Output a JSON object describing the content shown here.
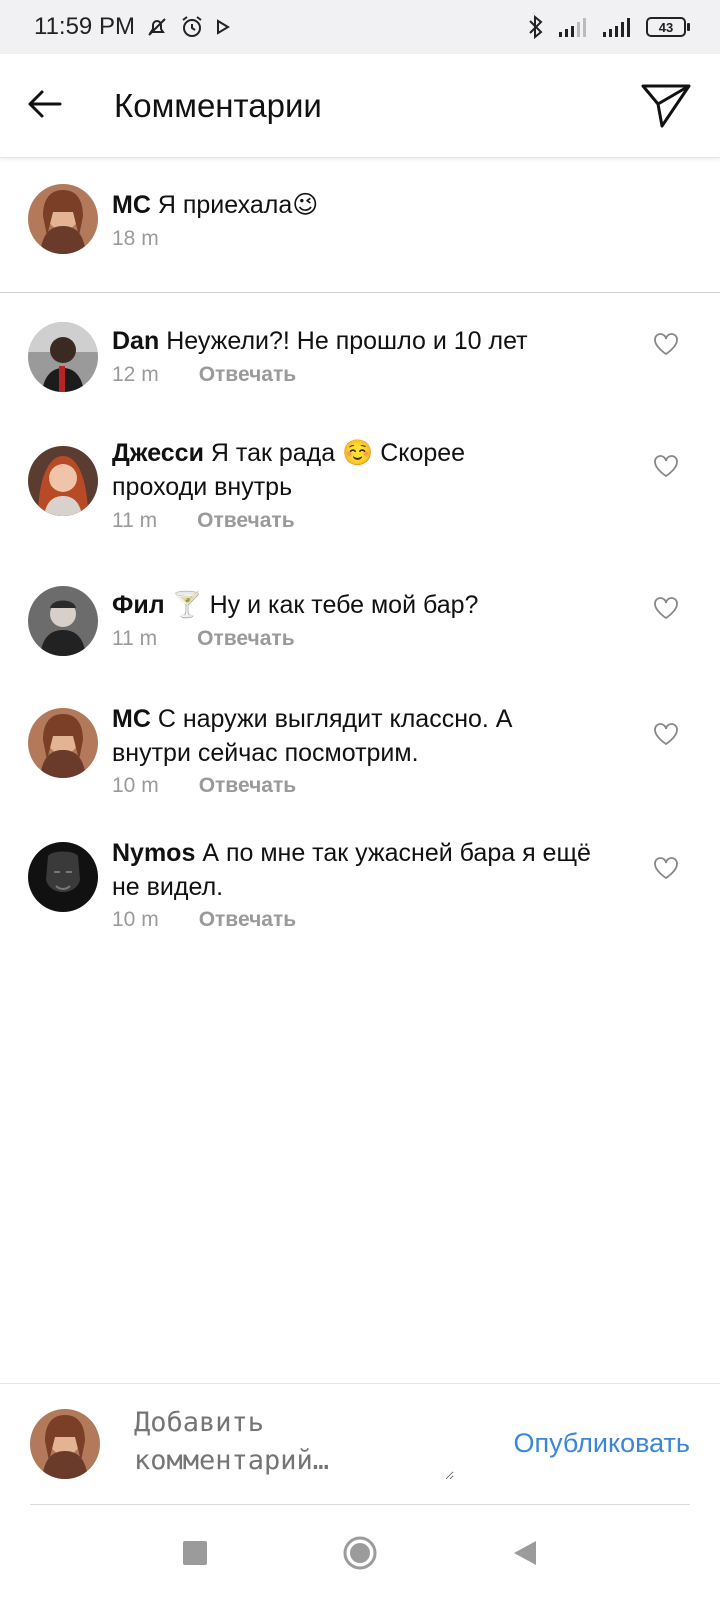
{
  "status_bar": {
    "time": "11:59 PM",
    "battery": "43"
  },
  "header": {
    "title": "Комментарии"
  },
  "caption": {
    "username": "MC",
    "text": "Я приехала😉",
    "time": "18 m"
  },
  "comments": [
    {
      "username": "Dan",
      "text": "Неужели?! Не прошло и 10 лет",
      "time": "12 m",
      "reply": "Отвечать"
    },
    {
      "username": "Джесси",
      "text": "Я так рада ☺️ Скорее проходи внутрь",
      "time": "11 m",
      "reply": "Отвечать"
    },
    {
      "username": "Фил",
      "text": "🍸 Ну и как тебе мой бар?",
      "time": "11 m",
      "reply": "Отвечать"
    },
    {
      "username": "MC",
      "text": "С наружи выглядит классно. А внутри сейчас посмотрим.",
      "time": "10 m",
      "reply": "Отвечать"
    },
    {
      "username": "Nymos",
      "text": "А по мне так ужасней бара я ещё не видел.",
      "time": "10 m",
      "reply": "Отвечать"
    }
  ],
  "composer": {
    "placeholder": "Добавить комментарий…",
    "publish_label": "Опубликовать"
  },
  "colors": {
    "accent": "#3b86d8",
    "secondary_text": "#9a9a9a"
  }
}
